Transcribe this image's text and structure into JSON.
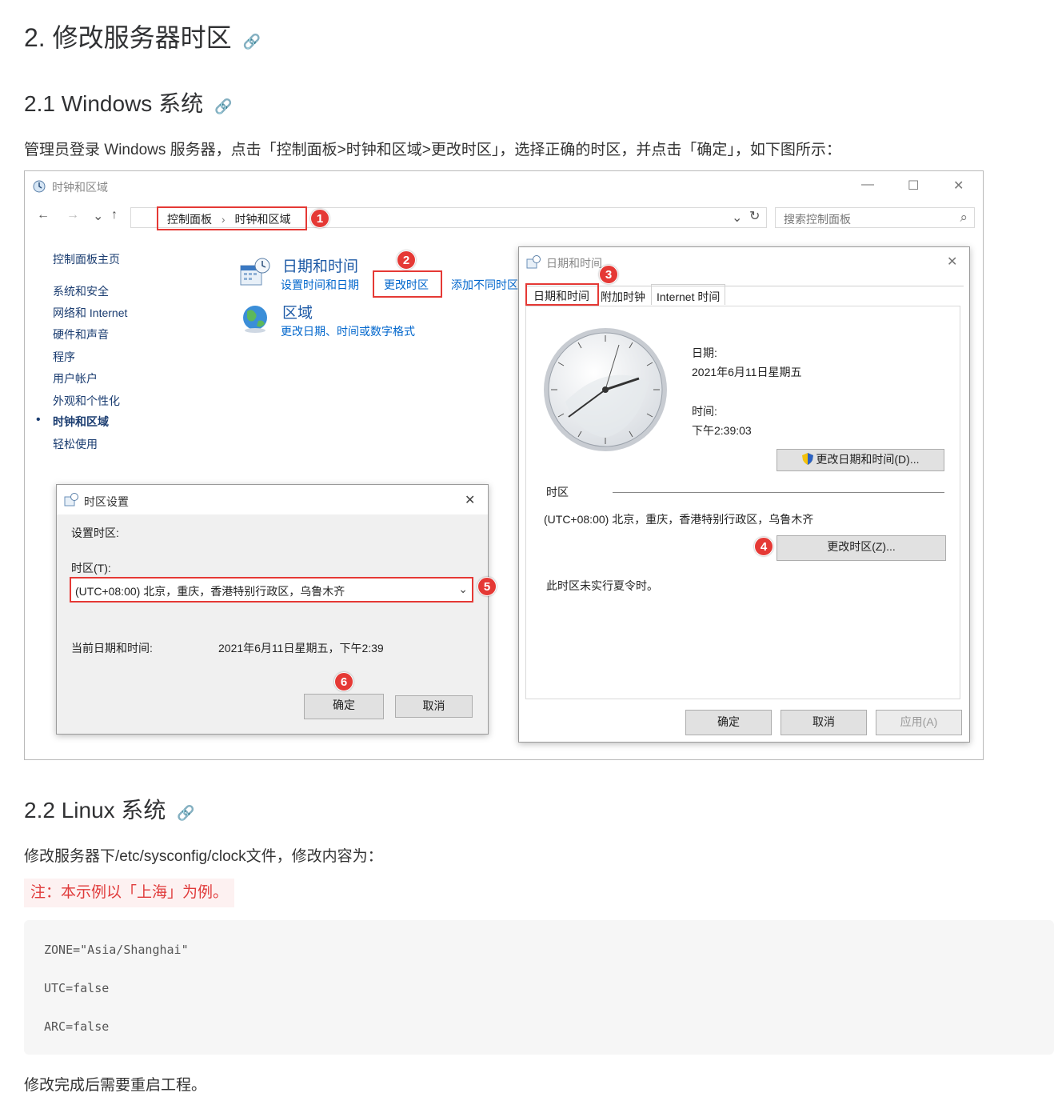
{
  "headings": {
    "h2": "2. 修改服务器时区",
    "windows": "2.1 Windows 系统",
    "linux": "2.2 Linux 系统",
    "anchor_symbol": "🔗"
  },
  "paragraphs": {
    "windows_intro": "管理员登录 Windows 服务器，点击「控制面板>时钟和区域>更改时区」，选择正确的时区，并点击「确定」，如下图所示：",
    "linux_intro": "修改服务器下/etc/sysconfig/clock文件，修改内容为：",
    "note": "注：本示例以「上海」为例。",
    "ending": "修改完成后需要重启工程。"
  },
  "code_lines": [
    "ZONE=\"Asia/Shanghai\"",
    "UTC=false",
    "ARC=false"
  ],
  "screenshot": {
    "window_title": "时钟和区域",
    "controls": {
      "minimize": "—",
      "maximize": "☐",
      "close": "✕"
    },
    "nav": {
      "back": "←",
      "forward": "→",
      "down": "⌄",
      "up": "↑",
      "dropdown": "⌄",
      "refresh": "↻"
    },
    "breadcrumb": {
      "part1": "控制面板",
      "sep": "›",
      "part2": "时钟和区域"
    },
    "search_placeholder": "搜索控制面板",
    "search_icon": "⌕",
    "sidebar": [
      "控制面板主页",
      "系统和安全",
      "网络和 Internet",
      "硬件和声音",
      "程序",
      "用户帐户",
      "外观和个性化",
      "时钟和区域",
      "轻松使用"
    ],
    "sidebar_active_index": 7,
    "bullet": "•",
    "categories": {
      "datetime": {
        "title": "日期和时间",
        "link1": "设置时间和日期",
        "link2": "更改时区",
        "link3": "添加不同时区"
      },
      "region": {
        "title": "区域",
        "link1": "更改日期、时间或数字格式"
      }
    },
    "badges": [
      "1",
      "2",
      "3",
      "4",
      "5",
      "6"
    ],
    "dt_dialog": {
      "title": "日期和时间",
      "tabs": [
        "日期和时间",
        "附加时钟",
        "Internet 时间"
      ],
      "date_label": "日期:",
      "date_value": "2021年6月11日星期五",
      "time_label": "时间:",
      "time_value": "下午2:39:03",
      "change_dt_button": "更改日期和时间(D)...",
      "tz_label": "时区",
      "tz_value": "(UTC+08:00) 北京，重庆，香港特别行政区，乌鲁木齐",
      "change_tz_button": "更改时区(Z)...",
      "dst_note": "此时区未实行夏令时。",
      "ok": "确定",
      "cancel": "取消",
      "apply": "应用(A)",
      "close": "✕"
    },
    "tz_dialog": {
      "title": "时区设置",
      "set_label": "设置时区:",
      "tz_field_label": "时区(T):",
      "tz_selected": "(UTC+08:00) 北京，重庆，香港特别行政区，乌鲁木齐",
      "select_arrow": "⌄",
      "current_label": "当前日期和时间:",
      "current_value": "2021年6月11日星期五，下午2:39",
      "ok": "确定",
      "cancel": "取消",
      "close": "✕"
    }
  },
  "colors": {
    "accent_red": "#e53935",
    "link_blue": "#0066cc",
    "note_red": "#e03b3b"
  }
}
